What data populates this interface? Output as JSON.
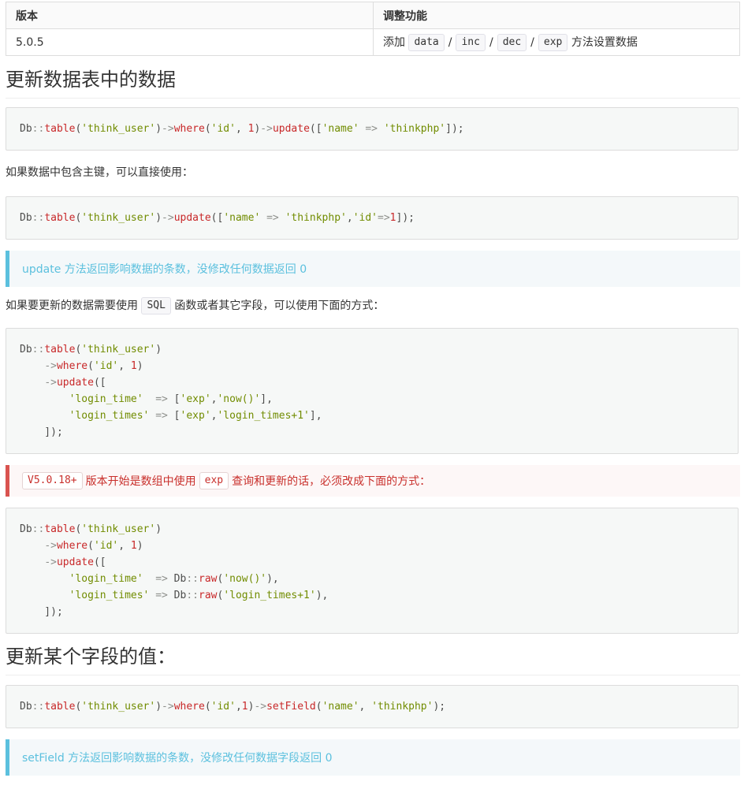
{
  "table": {
    "headers": [
      "版本",
      "调整功能"
    ],
    "row": {
      "version": "5.0.5",
      "prefix": "添加",
      "methods": [
        "data",
        "inc",
        "dec",
        "exp"
      ],
      "separator": "/",
      "suffix": "方法设置数据"
    }
  },
  "heading1": "更新数据表中的数据",
  "para1": "如果数据中包含主键，可以直接使用：",
  "note1": "update 方法返回影响数据的条数，没修改任何数据返回 0",
  "para2": {
    "before": "如果要更新的数据需要使用",
    "code": "SQL",
    "after": "函数或者其它字段，可以使用下面的方式："
  },
  "warning": {
    "badge": "V5.0.18+",
    "text1": "版本开始是数组中使用",
    "code": "exp",
    "text2": "查询和更新的话，必须改成下面的方式："
  },
  "heading2": "更新某个字段的值：",
  "note2": "setField 方法返回影响数据的条数，没修改任何数据字段返回 0"
}
